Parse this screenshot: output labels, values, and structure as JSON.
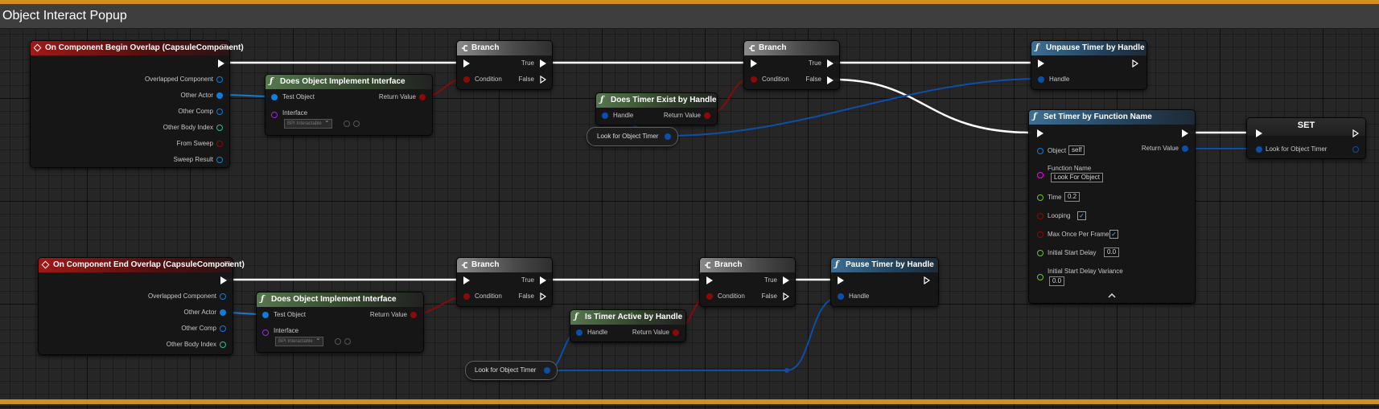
{
  "comment": {
    "title": "Object Interact Popup"
  },
  "colors": {
    "exec": "#ffffff",
    "object": "#0e7dde",
    "bool": "#8a0a0a",
    "struct": "#0d86d0",
    "int": "#2ec18c",
    "interface": "#9a28e0",
    "float": "#64c83c",
    "string": "#ff00ff",
    "band": "#d08f1e"
  },
  "nodes": {
    "begin_overlap": {
      "title": "On Component Begin Overlap (CapsuleComponent)",
      "pins": [
        "Overlapped Component",
        "Other Actor",
        "Other Comp",
        "Other Body Index",
        "From Sweep",
        "Sweep Result"
      ]
    },
    "does_impl_1": {
      "title": "Does Object Implement Interface",
      "test_object": "Test Object",
      "return_value": "Return Value",
      "interface": "Interface",
      "interface_value": "BPI Interactable"
    },
    "branch_1": {
      "title": "Branch",
      "condition": "Condition",
      "true": "True",
      "false": "False"
    },
    "branch_2": {
      "title": "Branch",
      "condition": "Condition",
      "true": "True",
      "false": "False"
    },
    "timer_exist": {
      "title": "Does Timer Exist by Handle",
      "handle": "Handle",
      "return_value": "Return Value"
    },
    "var_look_1": {
      "label": "Look for Object Timer"
    },
    "unpause": {
      "title": "Unpause Timer by Handle",
      "handle": "Handle"
    },
    "set_timer": {
      "title": "Set Timer by Function Name",
      "object": "Object",
      "object_value": "self",
      "return_value": "Return Value",
      "function_name": "Function Name",
      "function_value": "Look For Object",
      "time": "Time",
      "time_value": "0.2",
      "looping": "Looping",
      "looping_checked": true,
      "max_once": "Max Once Per Frame",
      "max_once_checked": true,
      "initial_delay": "Initial Start Delay",
      "initial_delay_value": "0.0",
      "initial_variance": "Initial Start Delay Variance",
      "initial_variance_value": "0.0"
    },
    "set_var": {
      "title": "SET",
      "pin": "Look for Object Timer"
    },
    "end_overlap": {
      "title": "On Component End Overlap (CapsuleComponent)",
      "pins": [
        "Overlapped Component",
        "Other Actor",
        "Other Comp",
        "Other Body Index"
      ]
    },
    "does_impl_2": {
      "title": "Does Object Implement Interface",
      "test_object": "Test Object",
      "return_value": "Return Value",
      "interface": "Interface",
      "interface_value": "BPI Interactable"
    },
    "branch_3": {
      "title": "Branch",
      "condition": "Condition",
      "true": "True",
      "false": "False"
    },
    "branch_4": {
      "title": "Branch",
      "condition": "Condition",
      "true": "True",
      "false": "False"
    },
    "timer_active": {
      "title": "Is Timer Active by Handle",
      "handle": "Handle",
      "return_value": "Return Value"
    },
    "var_look_2": {
      "label": "Look for Object Timer"
    },
    "pause": {
      "title": "Pause Timer by Handle",
      "handle": "Handle"
    }
  }
}
